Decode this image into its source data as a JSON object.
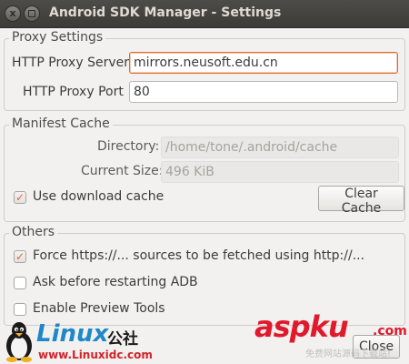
{
  "window": {
    "title": "Android SDK Manager - Settings",
    "close_glyph": "x",
    "minimize_glyph": ""
  },
  "proxy": {
    "group_label": "Proxy Settings",
    "server_label": "HTTP Proxy Server",
    "server_value": "mirrors.neusoft.edu.cn",
    "port_label": "HTTP Proxy Port",
    "port_value": "80"
  },
  "manifest": {
    "group_label": "Manifest Cache",
    "directory_label": "Directory:",
    "directory_value": "/home/tone/.android/cache",
    "size_label": "Current Size:",
    "size_value": "496 KiB",
    "use_cache_label": "Use download cache",
    "use_cache_checked": true,
    "clear_cache_label": "Clear Cache"
  },
  "others": {
    "group_label": "Others",
    "options": [
      {
        "label": "Force https://... sources to be fetched using http://...",
        "checked": true
      },
      {
        "label": "Ask before restarting ADB",
        "checked": false
      },
      {
        "label": "Enable Preview Tools",
        "checked": false
      }
    ]
  },
  "footer": {
    "close_label": "Close"
  },
  "watermarks": {
    "linux_text": "Linux",
    "linux_cn": "公社",
    "linux_url": "www.Linuxidc.com",
    "aspku_text": "aspku",
    "aspku_suffix": ".com",
    "aspku_sub": "免费网站源码下载站!"
  },
  "colors": {
    "accent": "#e2692a",
    "titlebar": "#3c3b37",
    "window_bg": "#f2f1f0"
  }
}
